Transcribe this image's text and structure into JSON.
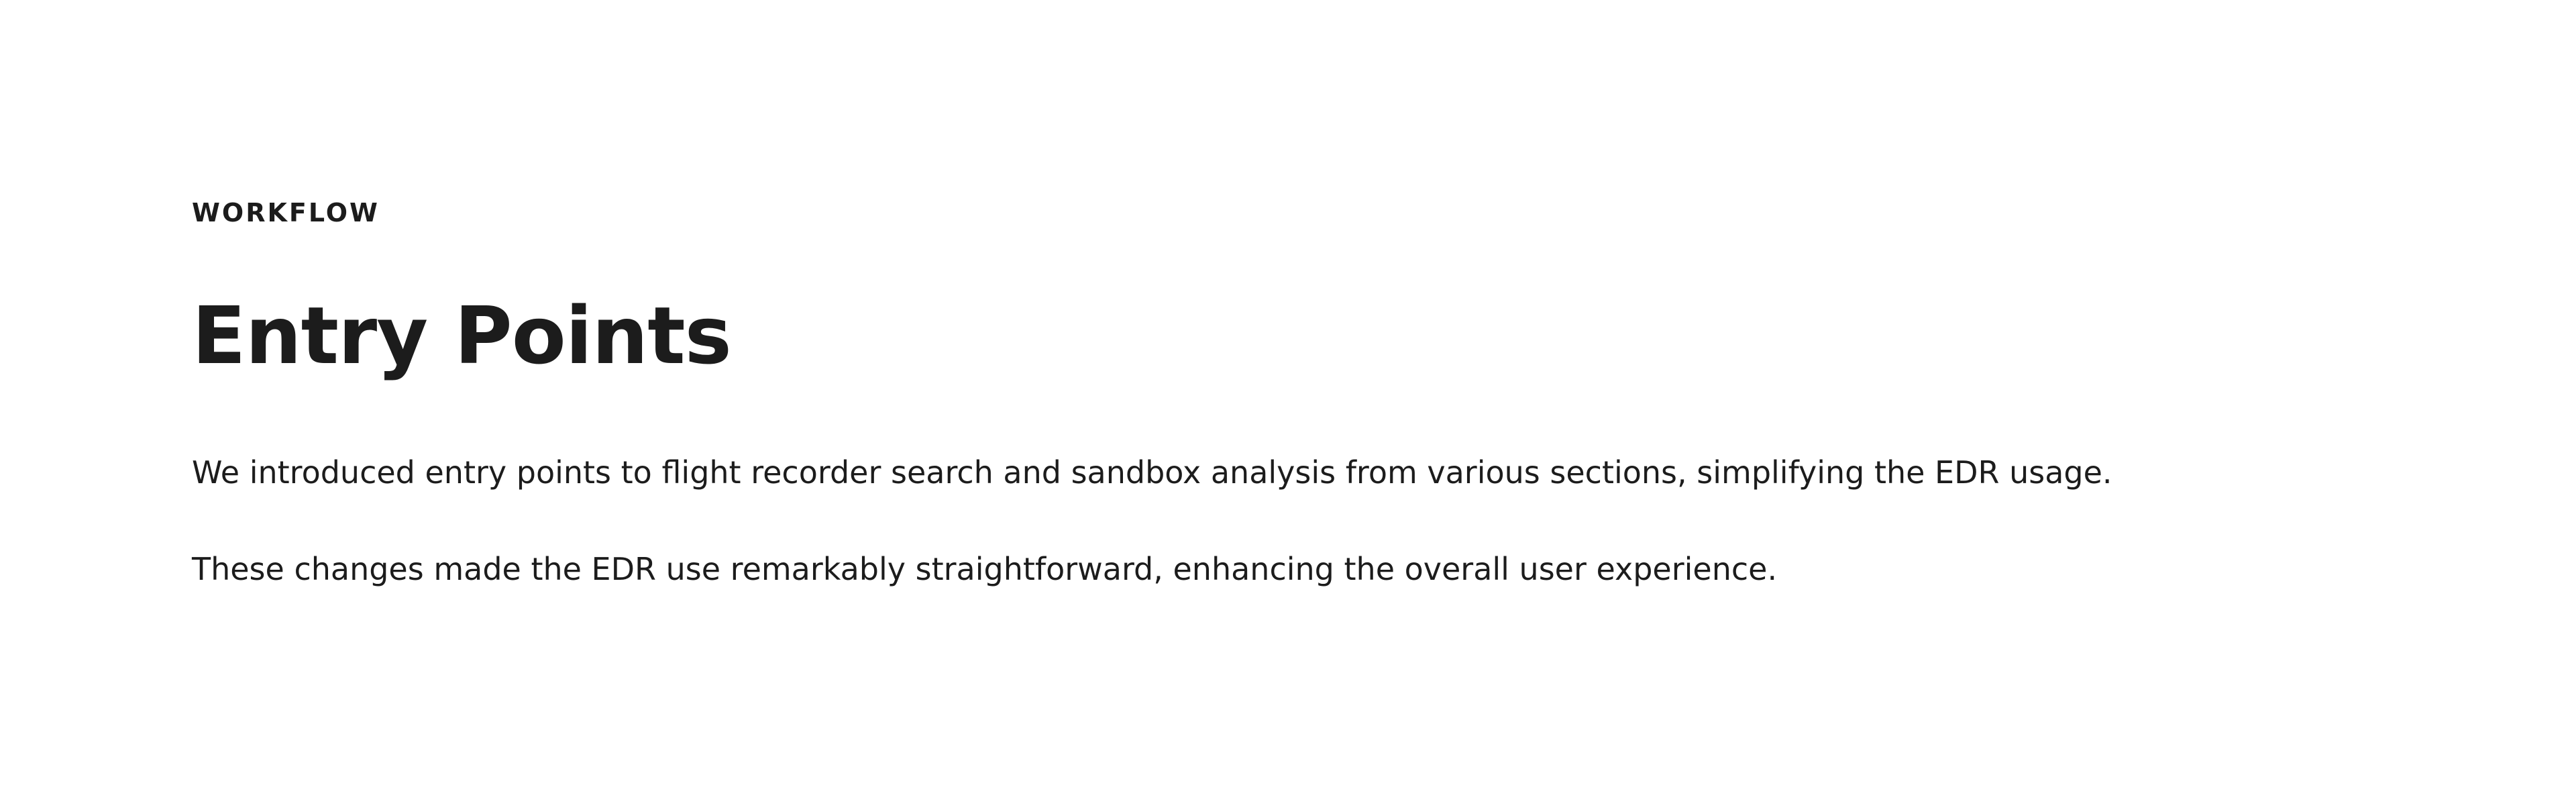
{
  "section": {
    "eyebrow": "WORKFLOW",
    "title": "Entry Points",
    "paragraphs": [
      "We introduced entry points to flight recorder search and sandbox analysis from various sections, simplifying the EDR usage.",
      "These changes made the EDR use remarkably straightforward, enhancing the overall user experience."
    ]
  },
  "colors": {
    "background": "#ffffff",
    "text": "#1c1c1c"
  }
}
